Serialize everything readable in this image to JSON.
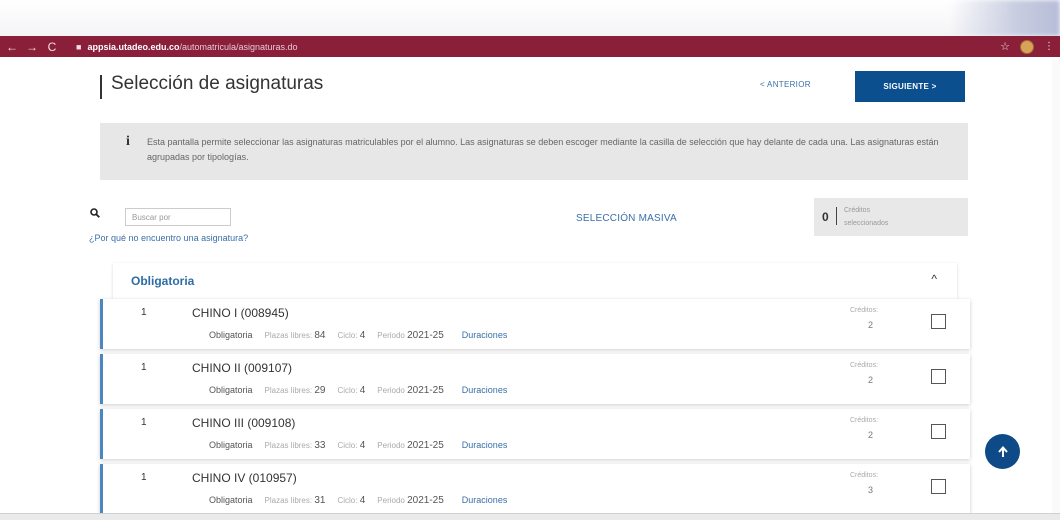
{
  "browser": {
    "back": "←",
    "forward": "→",
    "reload": "C",
    "domain": "appsia.utadeo.edu.co",
    "path": "/automatricula/asignaturas.do",
    "star": "☆",
    "more": "⋮"
  },
  "header": {
    "title": "Selección de asignaturas",
    "prev_label": "< ANTERIOR",
    "next_label": "SIGUIENTE >"
  },
  "info": {
    "icon": "i",
    "text": "Esta pantalla permite seleccionar las asignaturas matriculables por el alumno. Las asignaturas se deben escoger mediante la casilla de selección que hay delante de cada una. Las asignaturas están agrupadas por tipologías."
  },
  "search": {
    "placeholder": "Buscar por",
    "why_link": "¿Por qué no encuentro una asignatura?",
    "mass_select": "SELECCIÓN MASIVA"
  },
  "credits": {
    "count": "0",
    "label_line1": "Créditos",
    "label_line2": "seleccionados"
  },
  "group": {
    "title": "Obligatoria",
    "chevron": "^"
  },
  "courses": [
    {
      "num": "1",
      "name": "CHINO I (008945)",
      "type": "Obligatoria",
      "plazas_label": "Plazas libres:",
      "plazas": "84",
      "ciclo_label": "Ciclo:",
      "ciclo": "4",
      "periodo_label": "Periodo",
      "periodo": "2021-25",
      "duraciones": "Duraciones",
      "creditos_label": "Créditos:",
      "creditos": "2"
    },
    {
      "num": "1",
      "name": "CHINO II (009107)",
      "type": "Obligatoria",
      "plazas_label": "Plazas libres:",
      "plazas": "29",
      "ciclo_label": "Ciclo:",
      "ciclo": "4",
      "periodo_label": "Periodo",
      "periodo": "2021-25",
      "duraciones": "Duraciones",
      "creditos_label": "Créditos:",
      "creditos": "2"
    },
    {
      "num": "1",
      "name": "CHINO III (009108)",
      "type": "Obligatoria",
      "plazas_label": "Plazas libres:",
      "plazas": "33",
      "ciclo_label": "Ciclo:",
      "ciclo": "4",
      "periodo_label": "Periodo",
      "periodo": "2021-25",
      "duraciones": "Duraciones",
      "creditos_label": "Créditos:",
      "creditos": "2"
    },
    {
      "num": "1",
      "name": "CHINO IV (010957)",
      "type": "Obligatoria",
      "plazas_label": "Plazas libres:",
      "plazas": "31",
      "ciclo_label": "Ciclo:",
      "ciclo": "4",
      "periodo_label": "Periodo",
      "periodo": "2021-25",
      "duraciones": "Duraciones",
      "creditos_label": "Créditos:",
      "creditos": "3"
    }
  ],
  "colors": {
    "browser_bar": "#8a1f3a",
    "primary_button": "#0b4f8f",
    "link": "#3a6fa8",
    "row_accent": "#4a86c2"
  },
  "icons": {
    "info": "info-icon",
    "search": "search-icon",
    "scroll_top": "arrow-up-icon",
    "lock": "lock-icon"
  }
}
